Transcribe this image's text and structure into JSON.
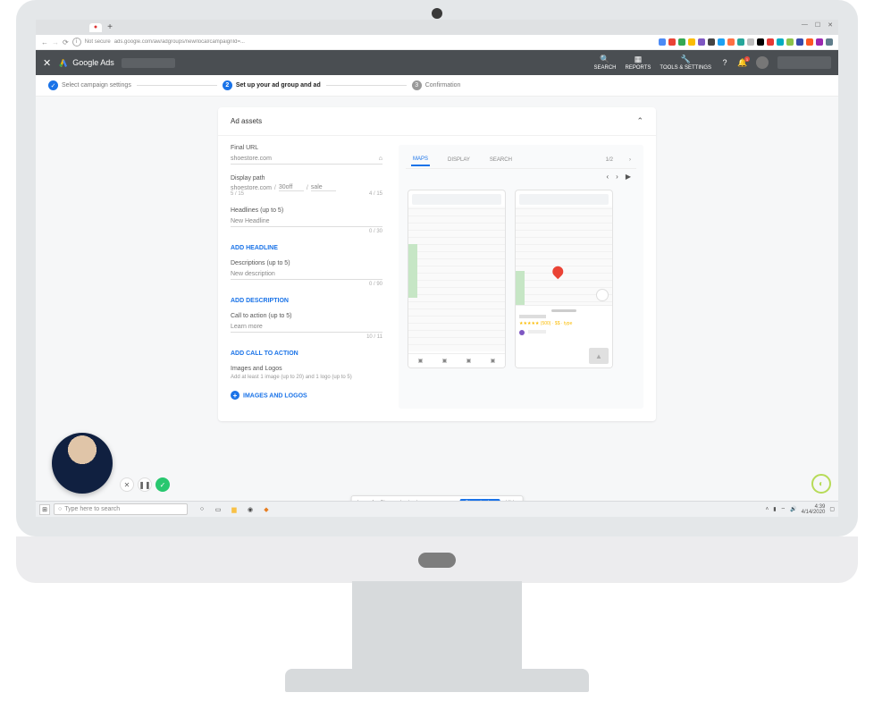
{
  "browser": {
    "url": "ads.google.com/aw/adgroups/new/local/campaignId=...",
    "security": "Not secure"
  },
  "gads": {
    "product": "Google Ads",
    "tools": {
      "search": "SEARCH",
      "reports": "REPORTS",
      "tools_settings": "TOOLS & SETTINGS"
    },
    "notif_count": "1"
  },
  "stepper": {
    "s1": "Select campaign settings",
    "s2": "Set up your ad group and ad",
    "s3": "Confirmation"
  },
  "card": {
    "title": "Ad assets",
    "final_url": {
      "label": "Final URL",
      "value": "shoestore.com"
    },
    "display_path": {
      "label": "Display path",
      "base": "shoestore.com",
      "p1": "30off",
      "p2": "sale",
      "c1": "5 / 15",
      "c2": "4 / 15"
    },
    "headlines": {
      "label": "Headlines (up to 5)",
      "value": "New Headline",
      "counter": "0 / 30",
      "add": "ADD HEADLINE"
    },
    "descriptions": {
      "label": "Descriptions (up to 5)",
      "value": "New description",
      "counter": "0 / 90",
      "add": "ADD DESCRIPTION"
    },
    "cta": {
      "label": "Call to action (up to 5)",
      "value": "Learn more",
      "counter": "10 / 11",
      "add": "ADD CALL TO ACTION"
    },
    "images": {
      "label": "Images and Logos",
      "helper": "Add at least 1 image (up to 20) and 1 logo (up to 5)",
      "add": "IMAGES AND LOGOS"
    }
  },
  "preview": {
    "tabs": {
      "maps": "MAPS",
      "display": "DISPLAY",
      "search": "SEARCH"
    },
    "size": "1/2",
    "rating_hint": "★★★★★ (500) · $$ · type"
  },
  "share": {
    "msg": "Loom for Chrome is sharing your screen.",
    "stop": "Stop sharing",
    "hide": "Hide"
  },
  "taskbar": {
    "search_placeholder": "Type here to search",
    "time": "4:39",
    "date": "4/14/2020"
  }
}
